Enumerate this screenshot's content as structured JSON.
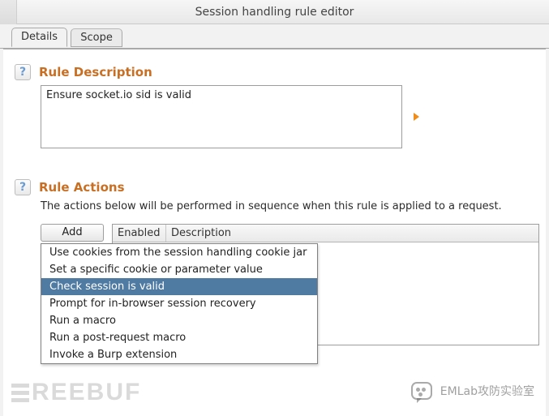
{
  "window": {
    "title": "Session handling rule editor"
  },
  "tabs": {
    "details": "Details",
    "scope": "Scope"
  },
  "ruleDescription": {
    "heading": "Rule Description",
    "value": "Ensure socket.io sid is valid"
  },
  "ruleActions": {
    "heading": "Rule Actions",
    "note": "The actions below will be performed in sequence when this rule is applied to a request.",
    "addButton": "Add",
    "columns": {
      "enabled": "Enabled",
      "description": "Description"
    }
  },
  "addMenu": {
    "items": [
      "Use cookies from the session handling cookie jar",
      "Set a specific cookie or parameter value",
      "Check session is valid",
      "Prompt for in-browser session recovery",
      "Run a macro",
      "Run a post-request macro",
      "Invoke a Burp extension"
    ],
    "selectedIndex": 2
  },
  "watermarks": {
    "left": "REEBUF",
    "right": "EMLab攻防实验室"
  }
}
